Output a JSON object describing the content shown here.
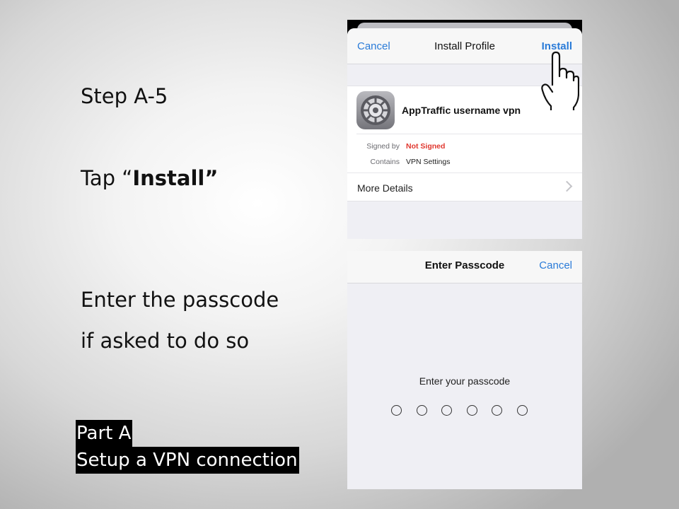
{
  "slide": {
    "step_title": "Step A-5",
    "tap_prefix": "Tap “",
    "tap_bold": "Install”",
    "passcode_line_1": "Enter the passcode",
    "passcode_line_2": "if asked to do so",
    "part_title": "Part A",
    "part_subtitle": "Setup a VPN connection"
  },
  "install_profile": {
    "cancel_label": "Cancel",
    "title": "Install Profile",
    "install_label": "Install",
    "profile_name": "AppTraffic username vpn",
    "signed_by_label": "Signed by",
    "signed_by_value": "Not Signed",
    "contains_label": "Contains",
    "contains_value": "VPN Settings",
    "more_details_label": "More Details",
    "icon": "gear-icon"
  },
  "enter_passcode": {
    "title": "Enter Passcode",
    "cancel_label": "Cancel",
    "prompt": "Enter your passcode",
    "digit_count": 6
  },
  "colors": {
    "ios_blue": "#2a7bd8",
    "not_signed_red": "#e0372e",
    "label_background": "#000000"
  }
}
